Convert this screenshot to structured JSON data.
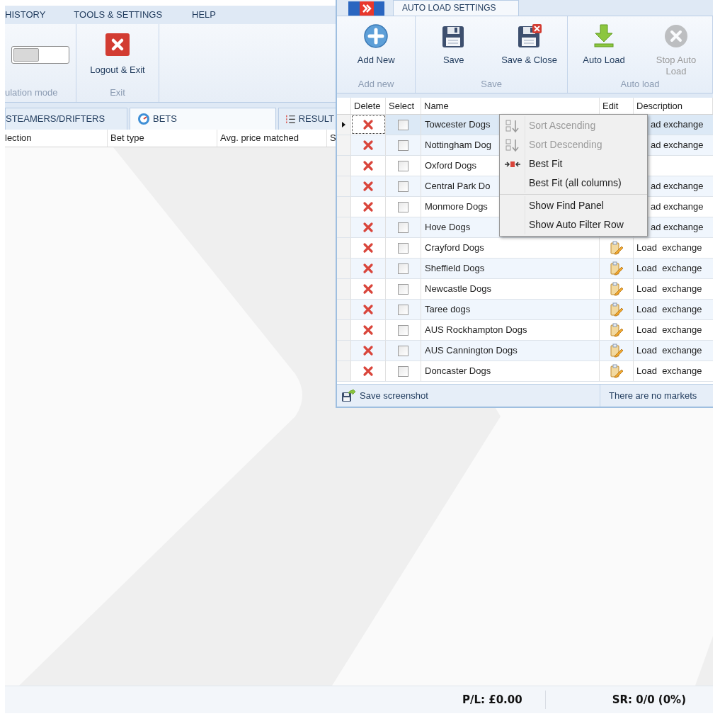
{
  "main_window": {
    "menu": [
      "HISTORY",
      "TOOLS & SETTINGS",
      "HELP"
    ],
    "ribbon_groups": [
      {
        "kind": "toggle",
        "label": "ulation mode",
        "on": false
      },
      {
        "kind": "button",
        "label": "Exit",
        "button": "Logout & Exit"
      }
    ],
    "tabs": [
      {
        "label": "STEAMERS/DRIFTERS",
        "selected": false
      },
      {
        "label": "BETS",
        "selected": true
      },
      {
        "label": "RESULT",
        "selected": false
      }
    ],
    "columns": [
      "lection",
      "Bet type",
      "Avg. price matched",
      "S"
    ],
    "status_bar": [
      "P/L: £0.00",
      "SR: 0/0 (0%)"
    ]
  },
  "dialog": {
    "tab": "AUTO LOAD SETTINGS",
    "ribbon_groups": [
      {
        "label": "Add new",
        "buttons": [
          {
            "label": "Add New",
            "disabled": false
          }
        ]
      },
      {
        "label": "Save",
        "buttons": [
          {
            "label": "Save",
            "disabled": false
          },
          {
            "label": "Save & Close",
            "disabled": false
          }
        ]
      },
      {
        "label": "Auto load",
        "buttons": [
          {
            "label": "Auto Load",
            "disabled": false
          },
          {
            "label": "Stop Auto Load",
            "disabled": true
          }
        ]
      }
    ],
    "grid": {
      "columns": [
        "Delete",
        "Select",
        "Name",
        "Edit",
        "Description"
      ],
      "rows": [
        {
          "name": "Towcester Dogs",
          "checked": false,
          "selected": true,
          "description": "ad exchange"
        },
        {
          "name": "Nottingham Dog",
          "checked": false,
          "selected": false,
          "description": "ad exchange"
        },
        {
          "name": "Oxford Dogs",
          "checked": false,
          "selected": false
        },
        {
          "name": "Central Park Do",
          "checked": false,
          "selected": false,
          "description": "ad exchange"
        },
        {
          "name": "Monmore Dogs",
          "checked": false,
          "selected": false,
          "description": "ad exchange"
        },
        {
          "name": "Hove Dogs",
          "checked": false,
          "selected": false,
          "description": "ad exchange"
        },
        {
          "name": "Crayford Dogs",
          "checked": false,
          "selected": false,
          "edit_icon": true,
          "description": "Load  exchange"
        },
        {
          "name": "Sheffield Dogs",
          "checked": false,
          "selected": false,
          "edit_icon": true,
          "description": "Load  exchange"
        },
        {
          "name": "Newcastle Dogs",
          "checked": false,
          "selected": false,
          "edit_icon": true,
          "description": "Load  exchange"
        },
        {
          "name": "Taree dogs",
          "checked": false,
          "selected": false,
          "edit_icon": true,
          "description": "Load  exchange"
        },
        {
          "name": "AUS Rockhampton Dogs",
          "checked": false,
          "selected": false,
          "edit_icon": true,
          "description": "Load  exchange"
        },
        {
          "name": "AUS Cannington Dogs",
          "checked": false,
          "selected": false,
          "edit_icon": true,
          "description": "Load  exchange"
        },
        {
          "name": "Doncaster Dogs",
          "checked": false,
          "selected": false,
          "edit_icon": true,
          "description": "Load  exchange"
        }
      ]
    },
    "status_button": "Save screenshot",
    "status_message": "There are no markets",
    "context_menu": {
      "groups": [
        [
          {
            "label": "Sort Ascending",
            "disabled": true
          },
          {
            "label": "Sort Descending",
            "disabled": true
          },
          {
            "label": "Best Fit",
            "disabled": false
          },
          {
            "label": "Best Fit (all columns)",
            "disabled": false
          }
        ],
        [
          {
            "label": "Show Find Panel",
            "disabled": false
          },
          {
            "label": "Show Auto Filter Row",
            "disabled": false
          }
        ]
      ]
    }
  }
}
